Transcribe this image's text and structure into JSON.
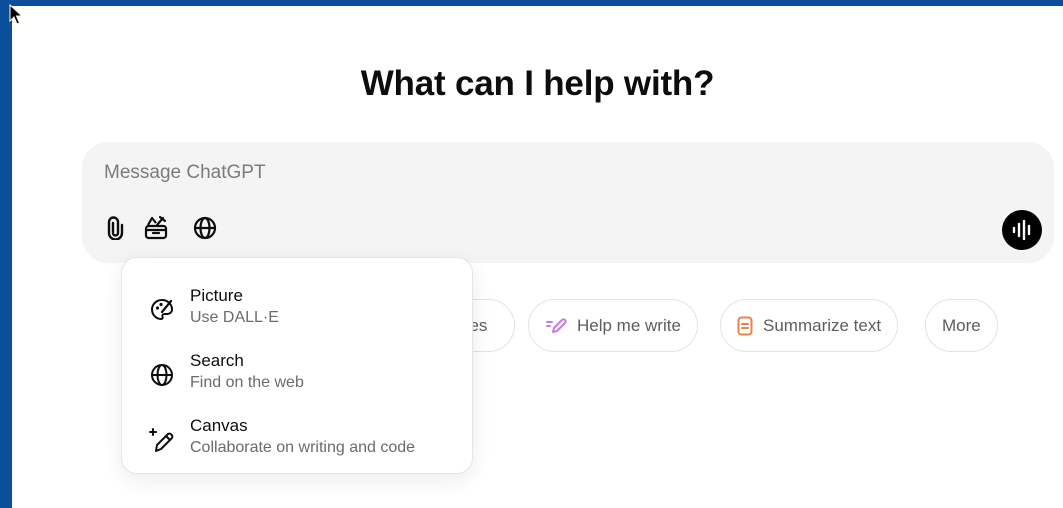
{
  "heading": "What can I help with?",
  "composer": {
    "placeholder": "Message ChatGPT",
    "tools": [
      {
        "icon": "paperclip-icon"
      },
      {
        "icon": "toolbox-icon"
      },
      {
        "icon": "globe-icon"
      }
    ],
    "voice_icon": "voice-waveform-icon"
  },
  "suggestions": [
    {
      "label": "ges",
      "icon": ""
    },
    {
      "label": "Help me write",
      "icon": "pen-icon",
      "icon_color": "#c57be5"
    },
    {
      "label": "Summarize text",
      "icon": "document-icon",
      "icon_color": "#e8834a"
    },
    {
      "label": "More",
      "icon": ""
    }
  ],
  "tools_menu": {
    "items": [
      {
        "label": "Picture",
        "sublabel": "Use DALL·E",
        "icon": "palette-icon"
      },
      {
        "label": "Search",
        "sublabel": "Find on the web",
        "icon": "globe-icon"
      },
      {
        "label": "Canvas",
        "sublabel": "Collaborate on writing and code",
        "icon": "pencil-sparkle-icon"
      }
    ]
  },
  "colors": {
    "desktop_background": "#0b4f9a",
    "composer_background": "#f4f4f4",
    "voice_button": "#000000"
  }
}
